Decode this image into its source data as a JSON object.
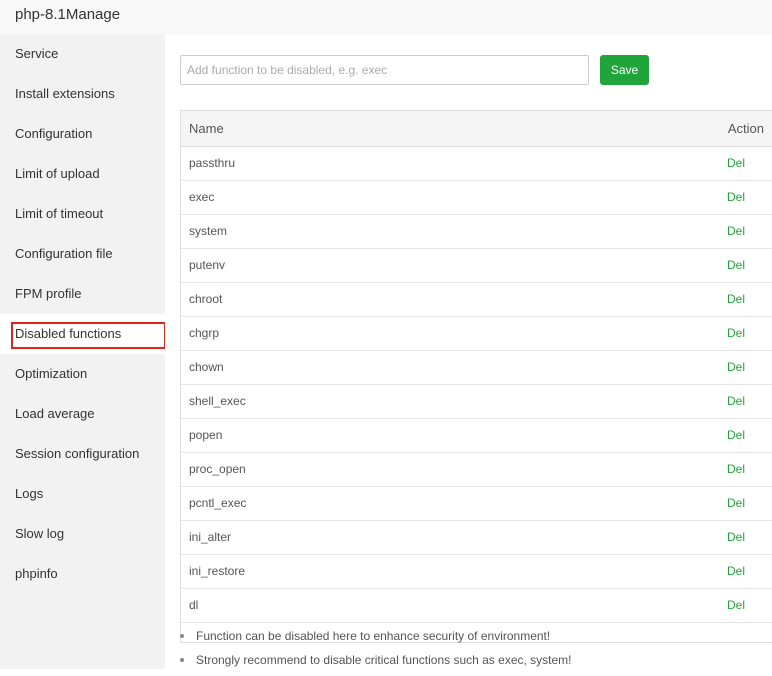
{
  "window": {
    "title": "php-8.1Manage"
  },
  "sidebar": {
    "items": [
      {
        "label": "Service"
      },
      {
        "label": "Install extensions"
      },
      {
        "label": "Configuration"
      },
      {
        "label": "Limit of upload"
      },
      {
        "label": "Limit of timeout"
      },
      {
        "label": "Configuration file"
      },
      {
        "label": "FPM profile"
      },
      {
        "label": "Disabled functions"
      },
      {
        "label": "Optimization"
      },
      {
        "label": "Load average"
      },
      {
        "label": "Session configuration"
      },
      {
        "label": "Logs"
      },
      {
        "label": "Slow log"
      },
      {
        "label": "phpinfo"
      }
    ],
    "active_index": 7
  },
  "form": {
    "input_placeholder": "Add function to be disabled, e.g. exec",
    "input_value": "",
    "save_label": "Save"
  },
  "table": {
    "columns": {
      "name": "Name",
      "action": "Action"
    },
    "action_label": "Del",
    "rows": [
      "passthru",
      "exec",
      "system",
      "putenv",
      "chroot",
      "chgrp",
      "chown",
      "shell_exec",
      "popen",
      "proc_open",
      "pcntl_exec",
      "ini_alter",
      "ini_restore",
      "dl"
    ]
  },
  "tips": [
    "Function can be disabled here to enhance security of environment!",
    "Strongly recommend to disable critical functions such as exec, system!"
  ],
  "colors": {
    "accent": "#20a53a",
    "highlight": "#e1251b"
  }
}
